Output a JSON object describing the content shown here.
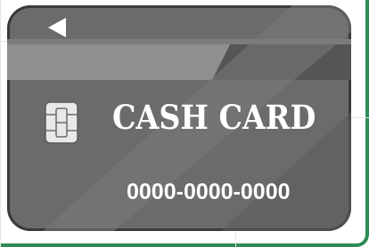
{
  "card": {
    "title": "CASH CARD",
    "number": "0000-0000-0000",
    "colors": {
      "body": "#6b6b6b",
      "stripe": "#8e8e8e",
      "stripe_dark": "#4f4f4f",
      "text": "#ffffff",
      "chip": "#e8e8e8",
      "frame": "#2e8b57"
    },
    "icons": {
      "back": "back-arrow-icon",
      "chip": "chip-icon"
    }
  }
}
